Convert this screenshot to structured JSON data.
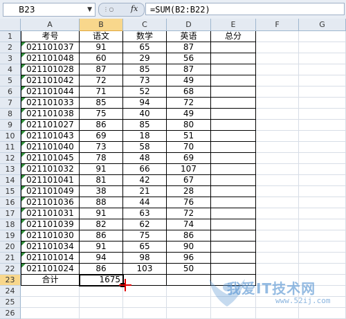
{
  "namebox": {
    "value": "B23",
    "arrow": "▼"
  },
  "formula": {
    "fx_label": "fx",
    "grip": "⋮ ○",
    "value": "=SUM(B2:B22)"
  },
  "columns": [
    "A",
    "B",
    "C",
    "D",
    "E",
    "F",
    "G"
  ],
  "rows": [
    {
      "n": "1",
      "a": "考号",
      "b": "语文",
      "c": "数学",
      "d": "英语",
      "e": "总分"
    },
    {
      "n": "2",
      "a": "021101037",
      "b": "91",
      "c": "65",
      "d": "87",
      "e": ""
    },
    {
      "n": "3",
      "a": "021101048",
      "b": "60",
      "c": "29",
      "d": "56",
      "e": ""
    },
    {
      "n": "4",
      "a": "021101028",
      "b": "87",
      "c": "85",
      "d": "87",
      "e": ""
    },
    {
      "n": "5",
      "a": "021101042",
      "b": "72",
      "c": "73",
      "d": "49",
      "e": ""
    },
    {
      "n": "6",
      "a": "021101044",
      "b": "71",
      "c": "52",
      "d": "68",
      "e": ""
    },
    {
      "n": "7",
      "a": "021101033",
      "b": "85",
      "c": "94",
      "d": "72",
      "e": ""
    },
    {
      "n": "8",
      "a": "021101038",
      "b": "75",
      "c": "40",
      "d": "49",
      "e": ""
    },
    {
      "n": "9",
      "a": "021101027",
      "b": "86",
      "c": "85",
      "d": "80",
      "e": ""
    },
    {
      "n": "10",
      "a": "021101043",
      "b": "69",
      "c": "18",
      "d": "51",
      "e": ""
    },
    {
      "n": "11",
      "a": "021101040",
      "b": "73",
      "c": "58",
      "d": "70",
      "e": ""
    },
    {
      "n": "12",
      "a": "021101045",
      "b": "78",
      "c": "48",
      "d": "69",
      "e": ""
    },
    {
      "n": "13",
      "a": "021101032",
      "b": "91",
      "c": "66",
      "d": "107",
      "e": ""
    },
    {
      "n": "14",
      "a": "021101041",
      "b": "81",
      "c": "42",
      "d": "67",
      "e": ""
    },
    {
      "n": "15",
      "a": "021101049",
      "b": "38",
      "c": "21",
      "d": "28",
      "e": ""
    },
    {
      "n": "16",
      "a": "021101036",
      "b": "88",
      "c": "44",
      "d": "76",
      "e": ""
    },
    {
      "n": "17",
      "a": "021101031",
      "b": "91",
      "c": "63",
      "d": "72",
      "e": ""
    },
    {
      "n": "18",
      "a": "021101039",
      "b": "82",
      "c": "62",
      "d": "74",
      "e": ""
    },
    {
      "n": "19",
      "a": "021101030",
      "b": "86",
      "c": "75",
      "d": "86",
      "e": ""
    },
    {
      "n": "20",
      "a": "021101034",
      "b": "91",
      "c": "65",
      "d": "90",
      "e": ""
    },
    {
      "n": "21",
      "a": "021101014",
      "b": "94",
      "c": "98",
      "d": "96",
      "e": ""
    },
    {
      "n": "22",
      "a": "021101024",
      "b": "86",
      "c": "103",
      "d": "50",
      "e": ""
    },
    {
      "n": "23",
      "a": "合计",
      "b": "1675",
      "c": "",
      "d": "",
      "e": ""
    },
    {
      "n": "24",
      "a": "",
      "b": "",
      "c": "",
      "d": "",
      "e": ""
    },
    {
      "n": "25",
      "a": "",
      "b": "",
      "c": "",
      "d": "",
      "e": ""
    },
    {
      "n": "26",
      "a": "",
      "b": "",
      "c": "",
      "d": "",
      "e": ""
    }
  ],
  "watermark": {
    "text": "我爱IT技术网",
    "url": "www.52ij.com"
  }
}
